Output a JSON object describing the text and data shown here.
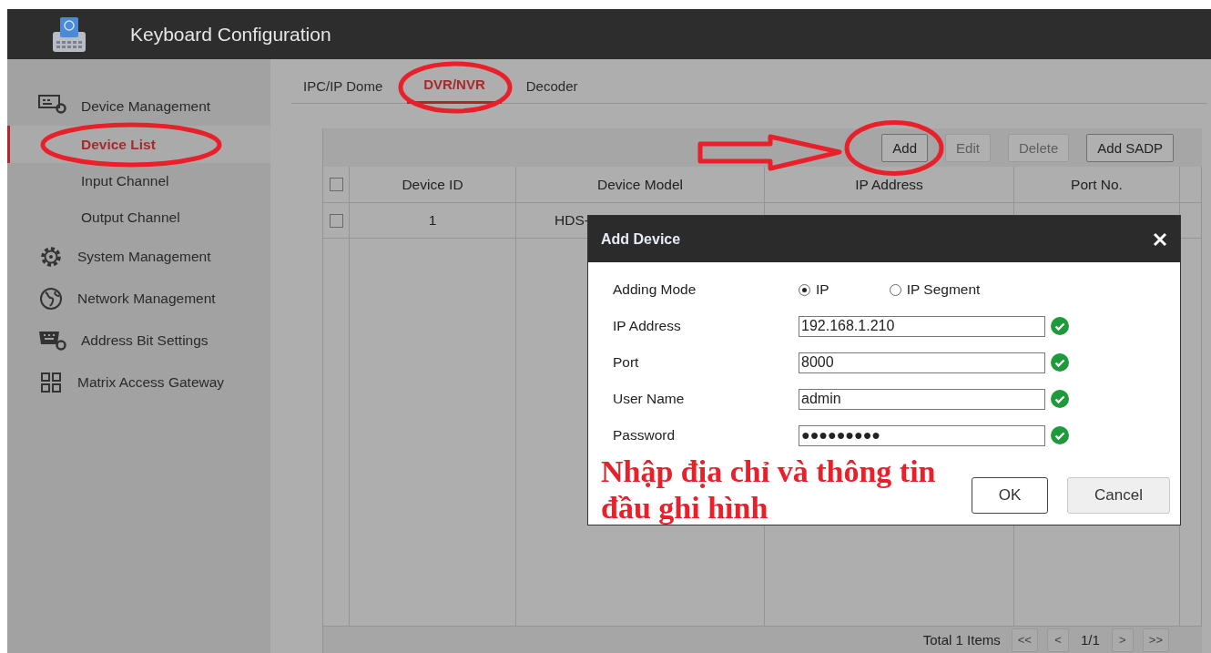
{
  "app": {
    "title": "Keyboard Configuration"
  },
  "sidebar": {
    "items": [
      {
        "label": "Device Management",
        "children": [
          {
            "label": "Device List",
            "selected": true
          },
          {
            "label": "Input Channel",
            "selected": false
          },
          {
            "label": "Output Channel",
            "selected": false
          }
        ]
      },
      {
        "label": "System Management"
      },
      {
        "label": "Network Management"
      },
      {
        "label": "Address Bit Settings"
      },
      {
        "label": "Matrix Access Gateway"
      }
    ]
  },
  "tabs": [
    {
      "label": "IPC/IP Dome",
      "selected": false
    },
    {
      "label": "DVR/NVR",
      "selected": true
    },
    {
      "label": "Decoder",
      "selected": false
    }
  ],
  "toolbar": {
    "buttons": [
      {
        "label": "Add",
        "disabled": false
      },
      {
        "label": "Edit",
        "disabled": true
      },
      {
        "label": "Delete",
        "disabled": true
      },
      {
        "label": "Add SADP",
        "disabled": false
      }
    ]
  },
  "table": {
    "header_checked": false,
    "columns": [
      "Device ID",
      "Device Model",
      "IP Address",
      "Port No."
    ],
    "rows": [
      {
        "checked": false,
        "cells": [
          "1",
          "HDS-"
        ]
      }
    ]
  },
  "footer": {
    "total": "Total 1 Items",
    "pager": [
      {
        "kind": "button",
        "label": "<<"
      },
      {
        "kind": "button",
        "label": "<"
      },
      {
        "kind": "text",
        "label": "1/1"
      },
      {
        "kind": "button",
        "label": ">"
      },
      {
        "kind": "button",
        "label": ">>"
      }
    ]
  },
  "dialog": {
    "title": "Add Device",
    "fields": [
      {
        "kind": "radio",
        "label": "Adding Mode",
        "options": [
          {
            "label": "IP",
            "selected": true
          },
          {
            "label": "IP Segment",
            "selected": false
          }
        ]
      },
      {
        "kind": "text",
        "label": "IP Address",
        "value": "192.168.1.210",
        "valid": true
      },
      {
        "kind": "text",
        "label": "Port",
        "value": "8000",
        "valid": true
      },
      {
        "kind": "text",
        "label": "User Name",
        "value": "admin",
        "valid": true
      },
      {
        "kind": "text",
        "label": "Password",
        "value": "●●●●●●●●●",
        "valid": true
      }
    ],
    "buttons": [
      {
        "label": "OK",
        "kind": "primary"
      },
      {
        "label": "Cancel",
        "kind": "secondary"
      }
    ]
  },
  "annotation": {
    "note": "Nhập địa chỉ và thông tin đầu ghi hình"
  }
}
